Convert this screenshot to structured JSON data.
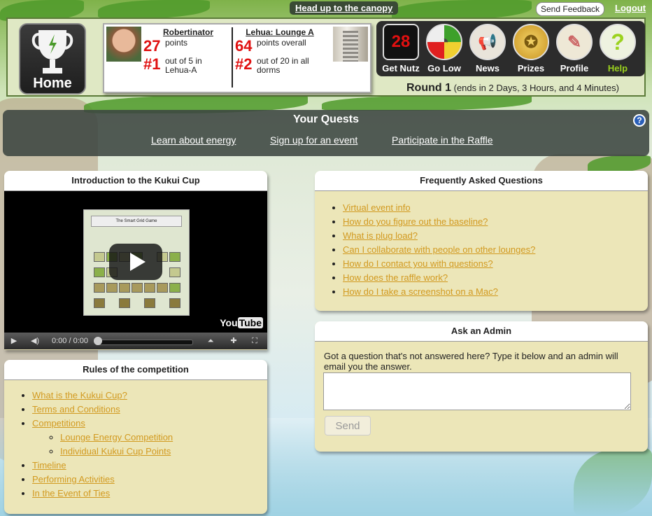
{
  "top": {
    "canopy_link": "Head up to the canopy",
    "send_feedback": "Send Feedback",
    "logout": "Logout"
  },
  "header": {
    "home_label": "Home",
    "user": {
      "name": "Robertinator",
      "points": "27",
      "points_label": "points",
      "rank": "#1",
      "rank_label": "out of 5 in Lehua-A"
    },
    "lounge": {
      "name": "Lehua: Lounge A",
      "points": "64",
      "points_label": "points overall",
      "rank": "#2",
      "rank_label": "out of 20 in all dorms"
    },
    "nav": [
      {
        "label": "Get Nutz",
        "icon": "counter-icon",
        "glyph": "28"
      },
      {
        "label": "Go Low",
        "icon": "gauge-icon",
        "glyph": "◔"
      },
      {
        "label": "News",
        "icon": "megaphone-icon",
        "glyph": "📢"
      },
      {
        "label": "Prizes",
        "icon": "medal-icon",
        "glyph": "✪"
      },
      {
        "label": "Profile",
        "icon": "notepad-icon",
        "glyph": "✎"
      },
      {
        "label": "Help",
        "icon": "question-icon",
        "glyph": "?"
      }
    ],
    "round": {
      "label": "Round 1",
      "ends": "(ends in 2 Days, 3 Hours, and 4 Minutes)"
    }
  },
  "quests": {
    "title": "Your Quests",
    "items": [
      "Learn about energy",
      "Sign up for an event",
      "Participate in the Raffle"
    ]
  },
  "intro": {
    "title": "Introduction to the Kukui Cup",
    "video_title": "The Smart Grid Game",
    "time": "0:00 / 0:00",
    "logo_you": "You",
    "logo_tube": "Tube"
  },
  "rules": {
    "title": "Rules of the competition",
    "items": [
      "What is the Kukui Cup?",
      "Terms and Conditions",
      "Competitions",
      "Lounge Energy Competition",
      "Individual Kukui Cup Points",
      "Timeline",
      "Performing Activities",
      "In the Event of Ties"
    ]
  },
  "faq": {
    "title": "Frequently Asked Questions",
    "items": [
      "Virtual event info",
      "How do you figure out the baseline?",
      "What is plug load?",
      "Can I collaborate with people on other lounges?",
      "How do I contact you with questions?",
      "How does the raffle work?",
      "How do I take a screenshot on a Mac?"
    ]
  },
  "admin": {
    "title": "Ask an Admin",
    "text": "Got a question that's not answered here? Type it below and an admin will email you the answer.",
    "input_value": "",
    "send": "Send"
  },
  "colors": {
    "accent_red": "#e01010",
    "link_gold": "#d29a20",
    "help_green": "#9bd21e"
  }
}
